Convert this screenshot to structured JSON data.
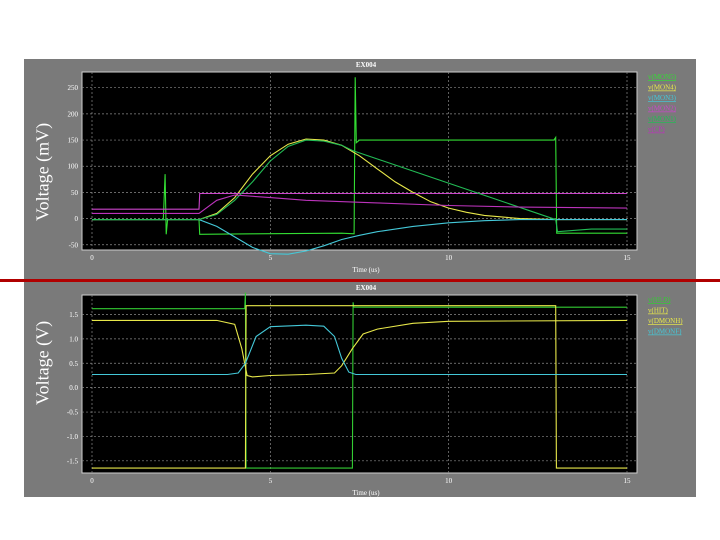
{
  "chart_data": [
    {
      "type": "line",
      "title": "EX004",
      "ylabel": "Voltage (mV)",
      "xlabel": "Time (us)",
      "xlim": [
        0,
        15
      ],
      "ylim": [
        -60,
        280
      ],
      "x_ticks": [
        0,
        5,
        10,
        15
      ],
      "y_ticks": [
        -50,
        0,
        50,
        100,
        150,
        200,
        250
      ],
      "grid": true,
      "legend_position": "top-right",
      "series": [
        {
          "name": "v(MON5)",
          "color": "#33dd33",
          "points": [
            [
              0,
              -2
            ],
            [
              2.0,
              -2
            ],
            [
              2.05,
              85
            ],
            [
              2.08,
              -30
            ],
            [
              2.12,
              -2
            ],
            [
              3.0,
              -2
            ],
            [
              3.02,
              -30
            ],
            [
              4.5,
              -29
            ],
            [
              7.0,
              -28
            ],
            [
              7.35,
              -29
            ],
            [
              7.38,
              270
            ],
            [
              7.41,
              145
            ],
            [
              7.5,
              150
            ],
            [
              12.95,
              150
            ],
            [
              13.0,
              155
            ],
            [
              13.03,
              -28
            ],
            [
              15,
              -28
            ]
          ]
        },
        {
          "name": "v(MON4)",
          "color": "#e8e84a",
          "points": [
            [
              0,
              -2
            ],
            [
              3.0,
              -2
            ],
            [
              3.5,
              10
            ],
            [
              4.0,
              40
            ],
            [
              4.5,
              85
            ],
            [
              5.0,
              120
            ],
            [
              5.5,
              142
            ],
            [
              6.0,
              152
            ],
            [
              6.5,
              150
            ],
            [
              7.0,
              140
            ],
            [
              7.5,
              120
            ],
            [
              8.0,
              95
            ],
            [
              8.5,
              70
            ],
            [
              9.0,
              50
            ],
            [
              9.5,
              32
            ],
            [
              10.0,
              20
            ],
            [
              10.5,
              12
            ],
            [
              11.0,
              6
            ],
            [
              12.0,
              0
            ],
            [
              13.0,
              -2
            ],
            [
              15,
              -2
            ]
          ]
        },
        {
          "name": "v(MON3)",
          "color": "#44c8d8",
          "points": [
            [
              0,
              -2
            ],
            [
              3.0,
              -2
            ],
            [
              3.5,
              -15
            ],
            [
              4.0,
              -35
            ],
            [
              4.5,
              -55
            ],
            [
              5.0,
              -67
            ],
            [
              5.5,
              -68
            ],
            [
              6.0,
              -62
            ],
            [
              6.5,
              -52
            ],
            [
              7.0,
              -40
            ],
            [
              7.5,
              -32
            ],
            [
              8.0,
              -25
            ],
            [
              9.0,
              -15
            ],
            [
              10.0,
              -8
            ],
            [
              11.0,
              -4
            ],
            [
              12.0,
              -2
            ],
            [
              15,
              -2
            ]
          ]
        },
        {
          "name": "v(MON2)",
          "color": "#cc44cc",
          "points": [
            [
              0,
              18
            ],
            [
              3.0,
              18
            ],
            [
              3.02,
              48
            ],
            [
              15,
              48
            ]
          ]
        },
        {
          "name": "v(MON1)",
          "color": "#22bb55",
          "points": [
            [
              0,
              -2
            ],
            [
              3.0,
              -2
            ],
            [
              3.5,
              8
            ],
            [
              4.0,
              35
            ],
            [
              4.5,
              70
            ],
            [
              5.0,
              110
            ],
            [
              5.5,
              138
            ],
            [
              6.0,
              150
            ],
            [
              6.5,
              148
            ],
            [
              7.0,
              140
            ],
            [
              7.3,
              130
            ],
            [
              13.0,
              -2
            ],
            [
              13.05,
              -25
            ],
            [
              14.0,
              -20
            ],
            [
              15,
              -20
            ]
          ]
        },
        {
          "name": "v(CP)",
          "color": "#bb33bb",
          "points": [
            [
              0,
              10
            ],
            [
              3.0,
              10
            ],
            [
              3.5,
              35
            ],
            [
              4.0,
              45
            ],
            [
              5.0,
              40
            ],
            [
              6.0,
              35
            ],
            [
              8.0,
              30
            ],
            [
              10.0,
              25
            ],
            [
              12.0,
              22
            ],
            [
              15,
              20
            ]
          ]
        }
      ]
    },
    {
      "type": "line",
      "title": "EX004",
      "ylabel": "Voltage (V)",
      "xlabel": "Time (us)",
      "xlim": [
        0,
        15
      ],
      "ylim": [
        -1.75,
        1.9
      ],
      "x_ticks": [
        0,
        5,
        10,
        15
      ],
      "y_ticks": [
        -1.5,
        -1.0,
        -0.5,
        0.0,
        0.5,
        1.0,
        1.5
      ],
      "grid": true,
      "legend_position": "top-right",
      "series": [
        {
          "name": "v(HLD)",
          "color": "#33cc33",
          "points": [
            [
              0,
              1.62
            ],
            [
              4.28,
              1.62
            ],
            [
              4.3,
              1.95
            ],
            [
              4.32,
              -1.65
            ],
            [
              7.3,
              -1.65
            ],
            [
              7.32,
              1.75
            ],
            [
              7.34,
              1.65
            ],
            [
              15,
              1.65
            ]
          ]
        },
        {
          "name": "v(HIT)",
          "color": "#e8e84a",
          "points": [
            [
              0,
              -1.65
            ],
            [
              4.3,
              -1.65
            ],
            [
              4.32,
              1.68
            ],
            [
              13.0,
              1.68
            ],
            [
              13.02,
              -1.65
            ],
            [
              15,
              -1.65
            ]
          ]
        },
        {
          "name": "v(DMONH)",
          "color": "#e8e84a",
          "points": [
            [
              0,
              1.38
            ],
            [
              3.5,
              1.38
            ],
            [
              4.0,
              1.3
            ],
            [
              4.2,
              0.8
            ],
            [
              4.35,
              0.25
            ],
            [
              4.5,
              0.22
            ],
            [
              5.0,
              0.25
            ],
            [
              6.0,
              0.27
            ],
            [
              6.8,
              0.3
            ],
            [
              7.0,
              0.45
            ],
            [
              7.3,
              0.8
            ],
            [
              7.6,
              1.1
            ],
            [
              8.0,
              1.2
            ],
            [
              9.0,
              1.32
            ],
            [
              10.0,
              1.36
            ],
            [
              15,
              1.38
            ]
          ]
        },
        {
          "name": "v(DMONF)",
          "color": "#44c8d8",
          "points": [
            [
              0,
              0.27
            ],
            [
              3.8,
              0.27
            ],
            [
              4.1,
              0.3
            ],
            [
              4.3,
              0.5
            ],
            [
              4.6,
              1.05
            ],
            [
              5.0,
              1.25
            ],
            [
              6.0,
              1.28
            ],
            [
              6.5,
              1.26
            ],
            [
              6.8,
              1.05
            ],
            [
              7.0,
              0.6
            ],
            [
              7.2,
              0.32
            ],
            [
              7.4,
              0.27
            ],
            [
              15,
              0.27
            ]
          ]
        }
      ]
    }
  ]
}
